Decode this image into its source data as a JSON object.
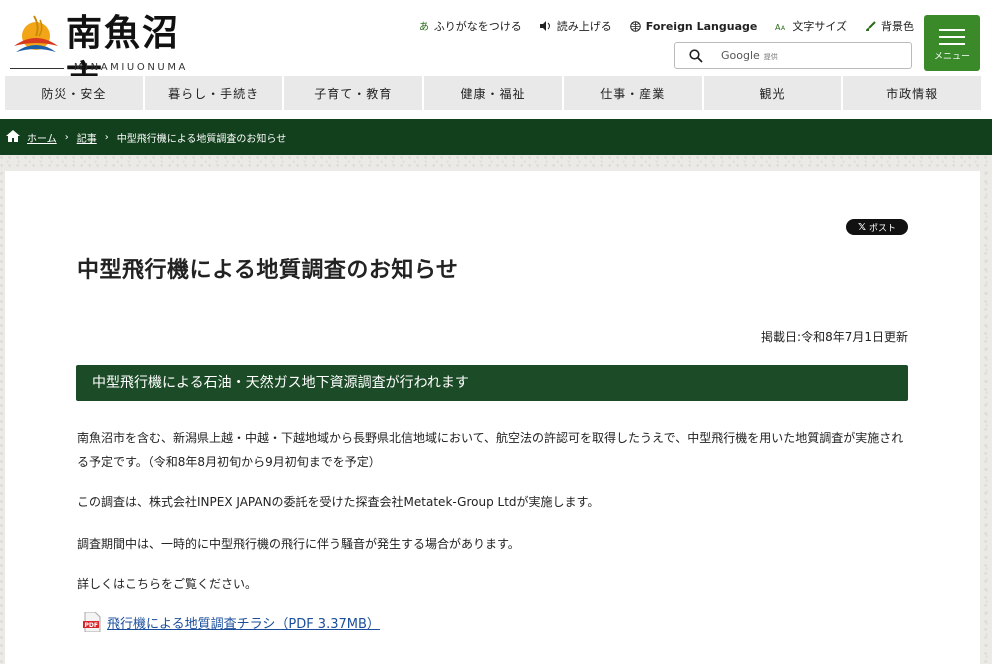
{
  "header": {
    "logo_text": "南魚沼市",
    "logo_sub": "MINAMIUONUMA",
    "utility": [
      {
        "label": "ふりがなをつける",
        "icon": "furigana-icon"
      },
      {
        "label": "読み上げる",
        "icon": "speaker-icon"
      },
      {
        "label": "Foreign Language",
        "icon": "globe-icon"
      },
      {
        "label": "文字サイズ",
        "icon": "text-size-icon"
      },
      {
        "label": "背景色",
        "icon": "brush-icon"
      }
    ],
    "search": {
      "label": "Google",
      "suffix": "提供"
    },
    "menu_label": "メニュー"
  },
  "nav": [
    "防災・安全",
    "暮らし・手続き",
    "子育て・教育",
    "健康・福祉",
    "仕事・産業",
    "観光",
    "市政情報"
  ],
  "breadcrumb": {
    "home": "ホーム",
    "section": "記事",
    "current": "中型飛行機による地質調査のお知らせ"
  },
  "share": {
    "label": "ポスト"
  },
  "article": {
    "title": "中型飛行機による地質調査のお知らせ",
    "updated": "掲載日:令和8年7月1日更新",
    "section_heading": "中型飛行機による石油・天然ガス地下資源調査が行われます",
    "paragraphs": [
      "南魚沼市を含む、新潟県上越・中越・下越地域から長野県北信地域において、航空法の許認可を取得したうえで、中型飛行機を用いた地質調査が実施される予定です。（令和8年8月初旬から9月初旬までを予定）",
      "この調査は、株式会社INPEX JAPANの委託を受けた探査会社Metatek-Group Ltdが実施します。",
      "調査期間中は、一時的に中型飛行機の飛行に伴う騒音が発生する場合があります。",
      "詳しくはこちらをご覧ください。"
    ],
    "attachment": {
      "label": "飛行機による地質調査チラシ（PDF 3.37MB）",
      "icon": "pdf-icon"
    }
  },
  "colors": {
    "brand_green": "#3a8a2a",
    "dark_green": "#123f1c",
    "heading_green": "#1c4c27",
    "link": "#1a4e9c"
  }
}
